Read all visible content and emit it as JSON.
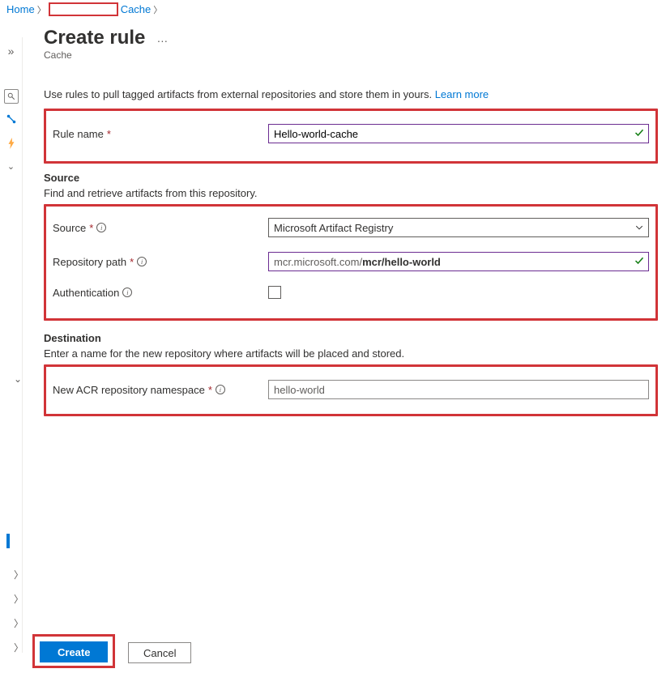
{
  "breadcrumb": {
    "home": "Home",
    "cache": "Cache"
  },
  "header": {
    "title": "Create rule",
    "subtitle": "Cache"
  },
  "description": {
    "text": "Use rules to pull tagged artifacts from external repositories and store them in yours.",
    "link": "Learn more"
  },
  "rule": {
    "name_label": "Rule name",
    "name_value": "Hello-world-cache"
  },
  "source": {
    "heading": "Source",
    "description": "Find and retrieve artifacts from this repository.",
    "source_label": "Source",
    "source_value": "Microsoft Artifact Registry",
    "repo_label": "Repository path",
    "repo_prefix": "mcr.microsoft.com/",
    "repo_value": "mcr/hello-world",
    "auth_label": "Authentication"
  },
  "destination": {
    "heading": "Destination",
    "description": "Enter a name for the new repository where artifacts will be placed and stored.",
    "namespace_label": "New ACR repository namespace",
    "namespace_value": "hello-world"
  },
  "footer": {
    "create": "Create",
    "cancel": "Cancel"
  }
}
